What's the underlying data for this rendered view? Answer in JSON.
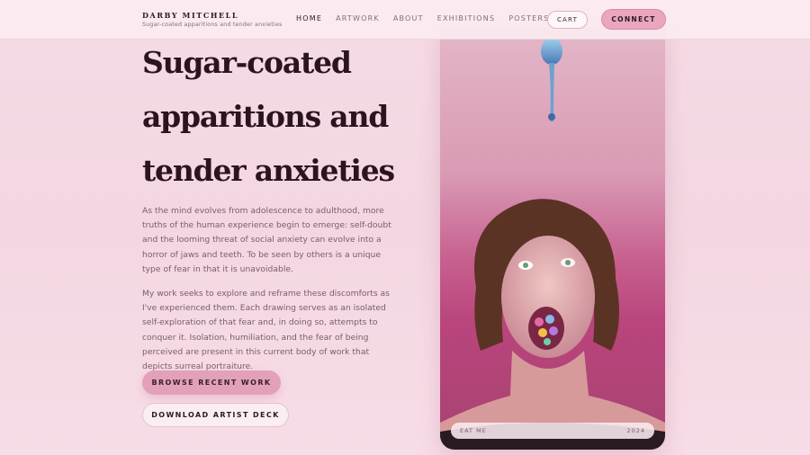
{
  "brand": {
    "name": "DARBY MITCHELL",
    "tagline": "Sugar-coated apparitions and tender anxieties"
  },
  "nav": {
    "items": [
      {
        "label": "HOME",
        "active": true
      },
      {
        "label": "ARTWORK",
        "active": false
      },
      {
        "label": "ABOUT",
        "active": false
      },
      {
        "label": "EXHIBITIONS",
        "active": false
      },
      {
        "label": "POSTERS",
        "active": false
      }
    ],
    "cart_label": "CART",
    "connect_label": "CONNECT"
  },
  "hero": {
    "headline_line1": "Sugar-coated",
    "headline_line2": "apparitions and",
    "headline_line3": "tender anxieties",
    "paragraph1": "As the mind evolves from adolescence to adulthood, more truths of the human experience begin to emerge: self-doubt and the looming threat of social anxiety can evolve into a horror of jaws and teeth. To be seen by others is a unique type of fear in that it is unavoidable.",
    "paragraph2": "My work seeks to explore and reframe these discomforts as I've experienced them. Each drawing serves as an isolated self-exploration of that fear and, in doing so, attempts to conquer it. Isolation, humiliation, and the fear of being perceived are present in this current body of work that depicts surreal portraiture.",
    "primary_button": "BROWSE RECENT WORK",
    "secondary_button": "DOWNLOAD ARTIST DECK"
  },
  "featured_artwork": {
    "title": "EAT ME",
    "year": "2024"
  },
  "colors": {
    "accent": "#eaa6bf",
    "headline": "#2b1420",
    "background": "#f5dbe5"
  }
}
